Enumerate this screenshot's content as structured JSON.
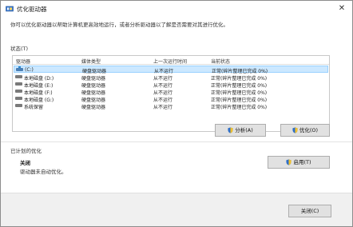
{
  "window": {
    "title": "优化驱动器",
    "close_glyph": "✕"
  },
  "intro": "你可以优化驱动器以帮助计算机更高效地运行，或者分析驱动器以了解是否需要对其进行优化。",
  "status_section": {
    "label": "状态(T)",
    "columns": [
      "驱动器",
      "媒体类型",
      "上一次运行时间",
      "当前状态"
    ],
    "rows": [
      {
        "drive": "(C:)",
        "media": "硬盘驱动器",
        "last_run": "从不运行",
        "status": "正常(碎片整理已完成 0%)",
        "selected": true,
        "icon": "system-drive-icon"
      },
      {
        "drive": "本地磁盘 (D:)",
        "media": "硬盘驱动器",
        "last_run": "从不运行",
        "status": "正常(碎片整理已完成 0%)",
        "selected": false,
        "icon": "drive-icon"
      },
      {
        "drive": "本地磁盘 (E:)",
        "media": "硬盘驱动器",
        "last_run": "从不运行",
        "status": "正常(碎片整理已完成 0%)",
        "selected": false,
        "icon": "drive-icon"
      },
      {
        "drive": "本地磁盘 (F:)",
        "media": "硬盘驱动器",
        "last_run": "从不运行",
        "status": "正常(碎片整理已完成 0%)",
        "selected": false,
        "icon": "drive-icon"
      },
      {
        "drive": "本地磁盘 (G:)",
        "media": "硬盘驱动器",
        "last_run": "从不运行",
        "status": "正常(碎片整理已完成 0%)",
        "selected": false,
        "icon": "drive-icon"
      },
      {
        "drive": "系统保留",
        "media": "硬盘驱动器",
        "last_run": "从不运行",
        "status": "正常(碎片整理已完成 0%)",
        "selected": false,
        "icon": "drive-icon"
      }
    ],
    "analyze_label": "分析(A)",
    "optimize_label": "优化(O)"
  },
  "schedule_section": {
    "label": "已计划的优化",
    "state": "关闭",
    "description": "驱动器未自动优化。",
    "enable_label": "启用(T)"
  },
  "footer": {
    "close_label": "关闭(C)"
  },
  "colors": {
    "selection": "#cce8ff",
    "selection_border": "#99d1ff",
    "shield_blue": "#2f6fc8",
    "shield_yellow": "#f2c12e"
  }
}
